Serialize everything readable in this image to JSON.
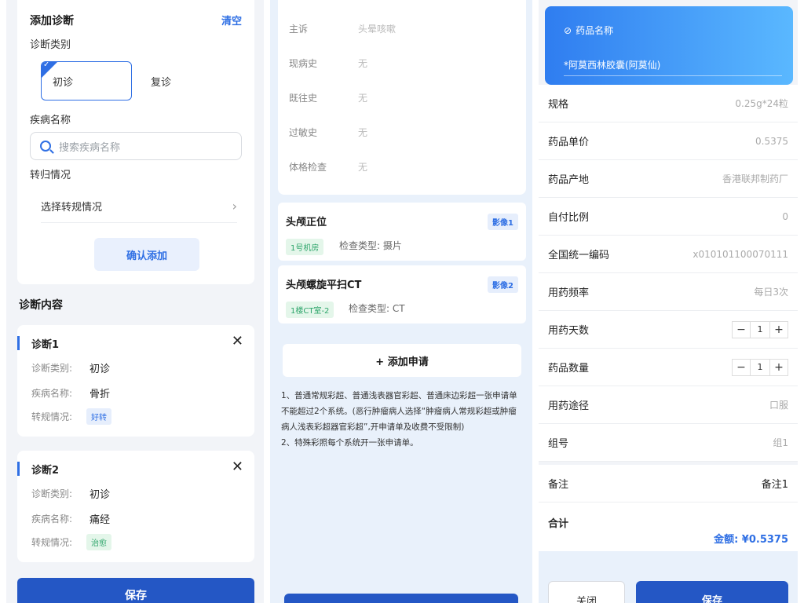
{
  "left": {
    "add_card": {
      "title": "添加诊断",
      "clear": "清空",
      "type_label": "诊断类别",
      "type_options": [
        "初诊",
        "复诊"
      ],
      "disease_label": "疾病名称",
      "search_placeholder": "搜索疾病名称",
      "outcome_label": "转归情况",
      "outcome_select": "选择转规情况",
      "confirm_button": "确认添加"
    },
    "section_title": "诊断内容",
    "diagnoses": [
      {
        "title": "诊断1",
        "type_key": "诊断类别:",
        "type_val": "初诊",
        "disease_key": "疾病名称:",
        "disease_val": "骨折",
        "outcome_key": "转规情况:",
        "outcome_val": "好转"
      },
      {
        "title": "诊断2",
        "type_key": "诊断类别:",
        "type_val": "初诊",
        "disease_key": "疾病名称:",
        "disease_val": "痛经",
        "outcome_key": "转规情况:",
        "outcome_val": "治愈"
      }
    ],
    "save_button": "保存"
  },
  "middle": {
    "history": [
      {
        "key": "主诉",
        "val": "头晕咳嗽"
      },
      {
        "key": "现病史",
        "val": "无"
      },
      {
        "key": "既往史",
        "val": "无"
      },
      {
        "key": "过敏史",
        "val": "无"
      },
      {
        "key": "体格检查",
        "val": "无"
      }
    ],
    "exams": [
      {
        "title": "头颅正位",
        "badge": "影像1",
        "room": "1号机房",
        "type": "检查类型: 摄片"
      },
      {
        "title": "头颅螺旋平扫CT",
        "badge": "影像2",
        "room": "1楼CT室-2",
        "type": "检查类型: CT"
      }
    ],
    "add_request": "+ 添加申请",
    "notes": "1、普通常规彩超、普通浅表器官彩超、普通床边彩超一张申请单不能超过2个系统。(恶行肿瘤病人选择“肿瘤病人常规彩超或肿瘤病人浅表彩超器官彩超”,开申请单及收费不受限制)\n2、特殊彩照每个系统开一张申请单。"
  },
  "right": {
    "drug_label": "药品名称",
    "drug_name": "*阿莫西林胶囊(阿莫仙)",
    "rows": [
      {
        "key": "规格",
        "val": "0.25g*24粒"
      },
      {
        "key": "药品单价",
        "val": "0.5375"
      },
      {
        "key": "药品产地",
        "val": "香港联邦制药厂"
      },
      {
        "key": "自付比例",
        "val": "0"
      },
      {
        "key": "全国统一编码",
        "val": "x010101100070111"
      },
      {
        "key": "用药频率",
        "val": "每日3次"
      },
      {
        "key": "用药天数",
        "val": "1"
      },
      {
        "key": "药品数量",
        "val": "1"
      },
      {
        "key": "用药途径",
        "val": "口服"
      },
      {
        "key": "组号",
        "val": "组1"
      },
      {
        "key": "备注",
        "val": "备注1"
      }
    ],
    "total_label": "合计",
    "amount": "金额: ¥0.5375",
    "close_button": "关闭",
    "save_button": "保存"
  }
}
